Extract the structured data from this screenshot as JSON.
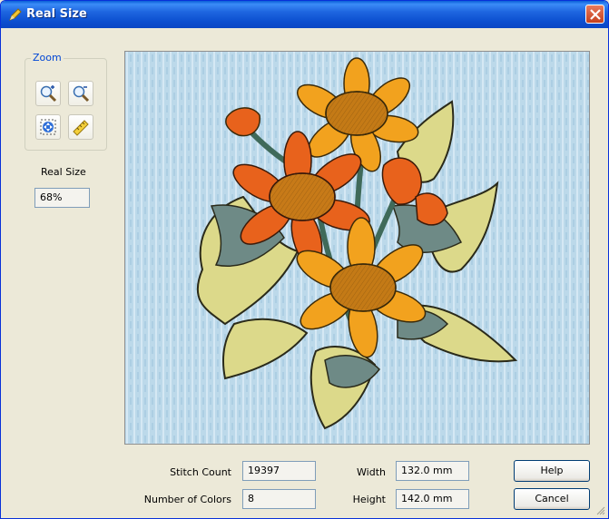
{
  "window": {
    "title": "Real Size"
  },
  "zoom": {
    "label": "Zoom"
  },
  "real_size": {
    "label": "Real Size",
    "value": "68%"
  },
  "stats": {
    "stitch_count_label": "Stitch Count",
    "stitch_count": "19397",
    "colors_label": "Number of Colors",
    "colors": "8",
    "width_label": "Width",
    "width": "132.0 mm",
    "height_label": "Height",
    "height": "142.0 mm"
  },
  "buttons": {
    "help": "Help",
    "cancel": "Cancel"
  },
  "colors": {
    "fabric": "#bcd9ea",
    "petal_orange": "#e8621c",
    "petal_yellow": "#f2a21e",
    "leaf_cream": "#dcd98a",
    "leaf_grey": "#6e8a86",
    "title_blue": "#0a5fd8"
  }
}
